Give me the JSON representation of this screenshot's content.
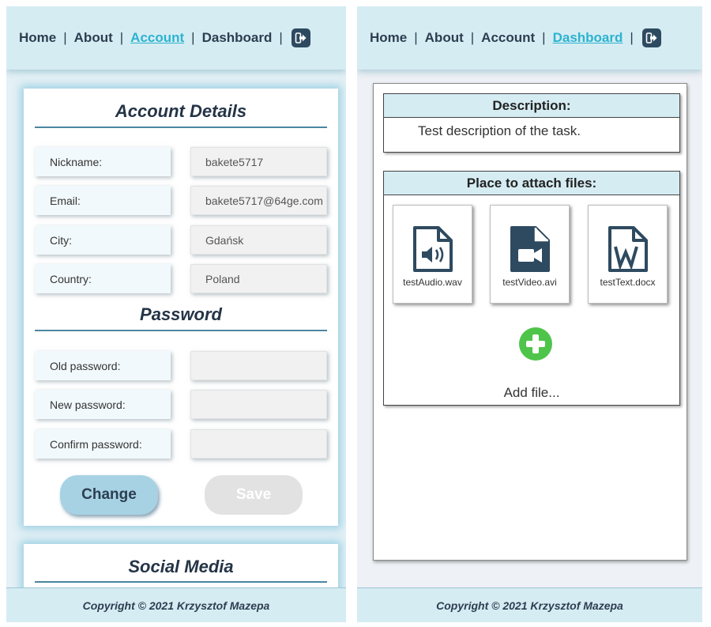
{
  "left_view": {
    "nav": {
      "items": [
        "Home",
        "About",
        "Account",
        "Dashboard"
      ],
      "separator": "|",
      "active": "Account",
      "logout_icon": "logout-icon"
    },
    "account_details": {
      "title": "Account Details",
      "fields": [
        {
          "label": "Nickname:",
          "value": "bakete5717"
        },
        {
          "label": "Email:",
          "value": "bakete5717@64ge.com"
        },
        {
          "label": "City:",
          "value": "Gdańsk"
        },
        {
          "label": "Country:",
          "value": "Poland"
        }
      ]
    },
    "password": {
      "title": "Password",
      "fields": [
        {
          "label": "Old password:",
          "value": ""
        },
        {
          "label": "New password:",
          "value": ""
        },
        {
          "label": "Confirm password:",
          "value": ""
        }
      ]
    },
    "buttons": {
      "change": "Change",
      "save": "Save"
    },
    "social_media": {
      "title": "Social Media"
    },
    "footer": "Copyright © 2021 Krzysztof Mazepa"
  },
  "right_view": {
    "nav": {
      "items": [
        "Home",
        "About",
        "Account",
        "Dashboard"
      ],
      "separator": "|",
      "active": "Dashboard",
      "logout_icon": "logout-icon"
    },
    "description": {
      "header": "Description:",
      "text": "Test description of the task."
    },
    "attachments": {
      "header": "Place to attach files:",
      "files": [
        {
          "name": "testAudio.wav",
          "icon": "audio-file-icon"
        },
        {
          "name": "testVideo.avi",
          "icon": "video-file-icon"
        },
        {
          "name": "testText.docx",
          "icon": "word-file-icon"
        }
      ],
      "add_label": "Add file...",
      "add_icon": "plus-circle-icon"
    },
    "footer": "Copyright © 2021 Krzysztof Mazepa"
  },
  "colors": {
    "nav_bg": "#d6ecf3",
    "active_link": "#2bb3cf",
    "text_dark": "#2c3e50",
    "section_rule": "#4b86a0",
    "change_button": "#a7d2e4",
    "save_button_disabled": "#e2e2e2",
    "add_button": "#4fc44a",
    "icon_dark": "#2e4a60"
  }
}
